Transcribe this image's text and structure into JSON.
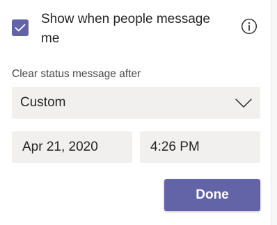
{
  "show_message": {
    "checked": true,
    "label": "Show when people message me",
    "info_icon": "info-circle-icon"
  },
  "clear_after": {
    "label": "Clear status message after",
    "selected": "Custom",
    "chevron_icon": "chevron-down-icon"
  },
  "date": {
    "value": "Apr 21, 2020"
  },
  "time": {
    "value": "4:26 PM"
  },
  "done_label": "Done",
  "colors": {
    "accent": "#6264a7",
    "field_bg": "#f1f0ef",
    "text": "#252423"
  }
}
